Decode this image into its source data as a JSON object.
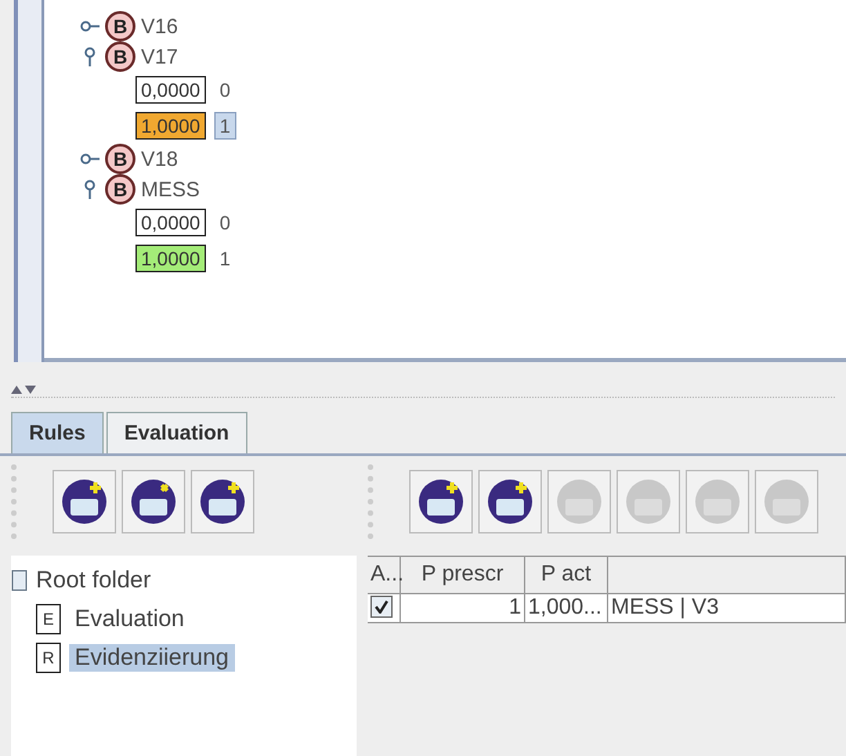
{
  "variables": [
    {
      "name": "V16",
      "badge": "B",
      "expanded": false
    },
    {
      "name": "V17",
      "badge": "B",
      "expanded": true,
      "states": [
        {
          "value": "0,0000",
          "label": "0",
          "color": "#ffffff",
          "selected": false
        },
        {
          "value": "1,0000",
          "label": "1",
          "color": "#f0a830",
          "selected": true
        }
      ]
    },
    {
      "name": "V18",
      "badge": "B",
      "expanded": false
    },
    {
      "name": "MESS",
      "badge": "B",
      "expanded": true,
      "states": [
        {
          "value": "0,0000",
          "label": "0",
          "color": "#ffffff",
          "selected": false
        },
        {
          "value": "1,0000",
          "label": "1",
          "color": "#a4ec78",
          "selected": false
        }
      ]
    }
  ],
  "tabs": [
    {
      "label": "Rules",
      "selected": true
    },
    {
      "label": "Evaluation",
      "selected": false
    }
  ],
  "left_toolbar": [
    {
      "disabled": false
    },
    {
      "disabled": false
    },
    {
      "disabled": false
    }
  ],
  "right_toolbar": [
    {
      "disabled": false
    },
    {
      "disabled": false
    },
    {
      "disabled": true
    },
    {
      "disabled": true
    },
    {
      "disabled": true
    },
    {
      "disabled": true
    }
  ],
  "folder_tree": {
    "label": "Root folder",
    "children": [
      {
        "letter": "E",
        "label": "Evaluation",
        "selected": false
      },
      {
        "letter": "R",
        "label": "Evidenziierung",
        "selected": true
      }
    ]
  },
  "table": {
    "columns": [
      "A...",
      "P prescr",
      "P act"
    ],
    "rows": [
      {
        "checked": true,
        "p_prescr": "1",
        "p_act": "1,000...",
        "column_4": "MESS | V3"
      }
    ]
  }
}
